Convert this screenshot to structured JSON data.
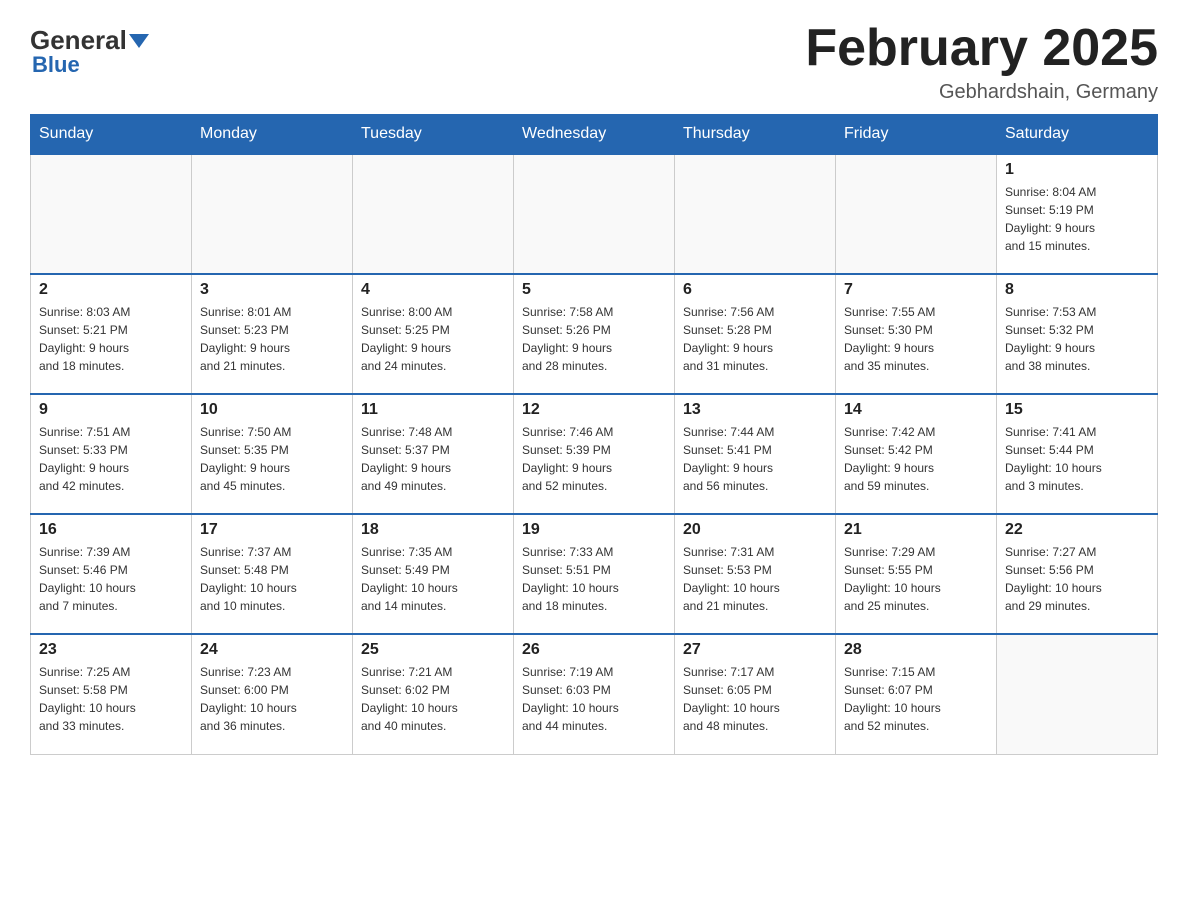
{
  "header": {
    "logo_text": "General",
    "logo_blue": "Blue",
    "month_title": "February 2025",
    "location": "Gebhardshain, Germany"
  },
  "weekdays": [
    "Sunday",
    "Monday",
    "Tuesday",
    "Wednesday",
    "Thursday",
    "Friday",
    "Saturday"
  ],
  "weeks": [
    [
      {
        "day": "",
        "info": ""
      },
      {
        "day": "",
        "info": ""
      },
      {
        "day": "",
        "info": ""
      },
      {
        "day": "",
        "info": ""
      },
      {
        "day": "",
        "info": ""
      },
      {
        "day": "",
        "info": ""
      },
      {
        "day": "1",
        "info": "Sunrise: 8:04 AM\nSunset: 5:19 PM\nDaylight: 9 hours\nand 15 minutes."
      }
    ],
    [
      {
        "day": "2",
        "info": "Sunrise: 8:03 AM\nSunset: 5:21 PM\nDaylight: 9 hours\nand 18 minutes."
      },
      {
        "day": "3",
        "info": "Sunrise: 8:01 AM\nSunset: 5:23 PM\nDaylight: 9 hours\nand 21 minutes."
      },
      {
        "day": "4",
        "info": "Sunrise: 8:00 AM\nSunset: 5:25 PM\nDaylight: 9 hours\nand 24 minutes."
      },
      {
        "day": "5",
        "info": "Sunrise: 7:58 AM\nSunset: 5:26 PM\nDaylight: 9 hours\nand 28 minutes."
      },
      {
        "day": "6",
        "info": "Sunrise: 7:56 AM\nSunset: 5:28 PM\nDaylight: 9 hours\nand 31 minutes."
      },
      {
        "day": "7",
        "info": "Sunrise: 7:55 AM\nSunset: 5:30 PM\nDaylight: 9 hours\nand 35 minutes."
      },
      {
        "day": "8",
        "info": "Sunrise: 7:53 AM\nSunset: 5:32 PM\nDaylight: 9 hours\nand 38 minutes."
      }
    ],
    [
      {
        "day": "9",
        "info": "Sunrise: 7:51 AM\nSunset: 5:33 PM\nDaylight: 9 hours\nand 42 minutes."
      },
      {
        "day": "10",
        "info": "Sunrise: 7:50 AM\nSunset: 5:35 PM\nDaylight: 9 hours\nand 45 minutes."
      },
      {
        "day": "11",
        "info": "Sunrise: 7:48 AM\nSunset: 5:37 PM\nDaylight: 9 hours\nand 49 minutes."
      },
      {
        "day": "12",
        "info": "Sunrise: 7:46 AM\nSunset: 5:39 PM\nDaylight: 9 hours\nand 52 minutes."
      },
      {
        "day": "13",
        "info": "Sunrise: 7:44 AM\nSunset: 5:41 PM\nDaylight: 9 hours\nand 56 minutes."
      },
      {
        "day": "14",
        "info": "Sunrise: 7:42 AM\nSunset: 5:42 PM\nDaylight: 9 hours\nand 59 minutes."
      },
      {
        "day": "15",
        "info": "Sunrise: 7:41 AM\nSunset: 5:44 PM\nDaylight: 10 hours\nand 3 minutes."
      }
    ],
    [
      {
        "day": "16",
        "info": "Sunrise: 7:39 AM\nSunset: 5:46 PM\nDaylight: 10 hours\nand 7 minutes."
      },
      {
        "day": "17",
        "info": "Sunrise: 7:37 AM\nSunset: 5:48 PM\nDaylight: 10 hours\nand 10 minutes."
      },
      {
        "day": "18",
        "info": "Sunrise: 7:35 AM\nSunset: 5:49 PM\nDaylight: 10 hours\nand 14 minutes."
      },
      {
        "day": "19",
        "info": "Sunrise: 7:33 AM\nSunset: 5:51 PM\nDaylight: 10 hours\nand 18 minutes."
      },
      {
        "day": "20",
        "info": "Sunrise: 7:31 AM\nSunset: 5:53 PM\nDaylight: 10 hours\nand 21 minutes."
      },
      {
        "day": "21",
        "info": "Sunrise: 7:29 AM\nSunset: 5:55 PM\nDaylight: 10 hours\nand 25 minutes."
      },
      {
        "day": "22",
        "info": "Sunrise: 7:27 AM\nSunset: 5:56 PM\nDaylight: 10 hours\nand 29 minutes."
      }
    ],
    [
      {
        "day": "23",
        "info": "Sunrise: 7:25 AM\nSunset: 5:58 PM\nDaylight: 10 hours\nand 33 minutes."
      },
      {
        "day": "24",
        "info": "Sunrise: 7:23 AM\nSunset: 6:00 PM\nDaylight: 10 hours\nand 36 minutes."
      },
      {
        "day": "25",
        "info": "Sunrise: 7:21 AM\nSunset: 6:02 PM\nDaylight: 10 hours\nand 40 minutes."
      },
      {
        "day": "26",
        "info": "Sunrise: 7:19 AM\nSunset: 6:03 PM\nDaylight: 10 hours\nand 44 minutes."
      },
      {
        "day": "27",
        "info": "Sunrise: 7:17 AM\nSunset: 6:05 PM\nDaylight: 10 hours\nand 48 minutes."
      },
      {
        "day": "28",
        "info": "Sunrise: 7:15 AM\nSunset: 6:07 PM\nDaylight: 10 hours\nand 52 minutes."
      },
      {
        "day": "",
        "info": ""
      }
    ]
  ]
}
